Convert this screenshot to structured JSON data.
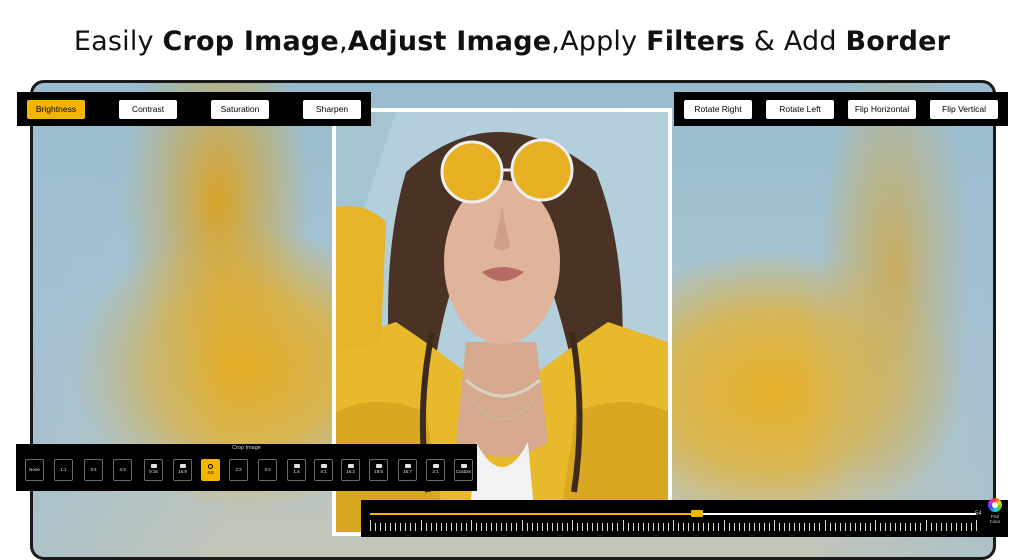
{
  "headline": {
    "p1": "Easily ",
    "b1": "Crop Image",
    "p2": ",",
    "b2": "Adjust Image",
    "p3": ",Apply ",
    "b3": "Filters",
    "p4": " & Add ",
    "b4": "Border"
  },
  "adjust_toolbar": {
    "items": [
      {
        "label": "Brightness",
        "active": true
      },
      {
        "label": "Contrast",
        "active": false
      },
      {
        "label": "Saturation",
        "active": false
      },
      {
        "label": "Sharpen",
        "active": false
      }
    ]
  },
  "transform_toolbar": {
    "items": [
      {
        "label": "Rotate Right"
      },
      {
        "label": "Rotate Left"
      },
      {
        "label": "Flip Horizontal"
      },
      {
        "label": "Flip Vertical"
      }
    ]
  },
  "crop": {
    "title": "Crop Image",
    "ratios": [
      {
        "label": "None",
        "icon": "none"
      },
      {
        "label": "1:1",
        "icon": "none"
      },
      {
        "label": "3:4",
        "icon": "none"
      },
      {
        "label": "4:3",
        "icon": "none"
      },
      {
        "label": "9:16",
        "icon": "tiktok-icon"
      },
      {
        "label": "16:9",
        "icon": "youtube-icon"
      },
      {
        "label": "4:5",
        "icon": "instagram-icon",
        "active": true
      },
      {
        "label": "2:3",
        "icon": "none"
      },
      {
        "label": "3:2",
        "icon": "none"
      },
      {
        "label": "1:4",
        "icon": "facebook-icon"
      },
      {
        "label": "4:1",
        "icon": "facebook-icon"
      },
      {
        "label": "16:2",
        "icon": "linkedin-icon"
      },
      {
        "label": "19:5",
        "icon": "twitter-icon"
      },
      {
        "label": "16:7",
        "icon": "youtube-icon"
      },
      {
        "label": "2:1",
        "icon": "twitter-icon"
      },
      {
        "label": "Custom",
        "icon": "custom-icon"
      }
    ]
  },
  "adjust_slider": {
    "value": 54,
    "value_label": "54",
    "pick_color_label": "Pick\nColor"
  },
  "colors": {
    "accent": "#f4b400",
    "toolbar_bg": "#000000"
  }
}
